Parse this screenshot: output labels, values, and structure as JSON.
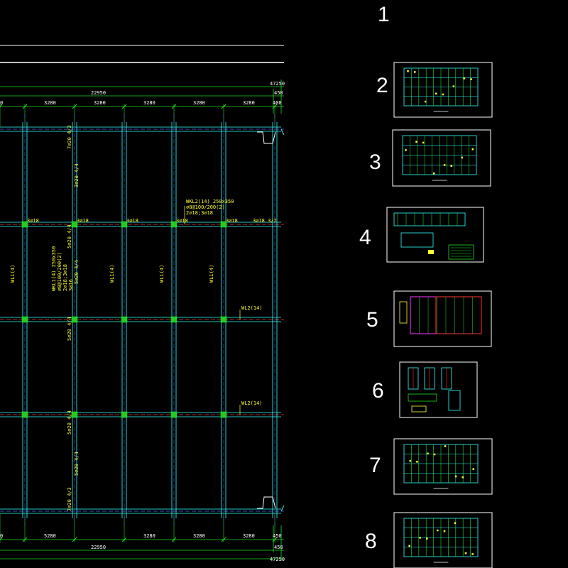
{
  "colors": {
    "background": "#000000",
    "frame": "#ffffff",
    "dimension": "#22dd22",
    "beam": "#33ffff",
    "axis": "#5a66ff",
    "axis_red": "#ff3333",
    "annotation": "#ffff33",
    "node": "#22cc22"
  },
  "plan": {
    "dim_total_top": "47250",
    "dim_total_bottom": "47250",
    "dim_span_top": "22950",
    "dim_span_bottom": "22950",
    "dim_end_top": "450",
    "dim_end_bottom": "450",
    "dim_end2_top": "400",
    "dim_end2_bottom": "450",
    "bay_top": [
      "3280",
      "3280",
      "3280",
      "3280",
      "3280"
    ],
    "bay_bottom": [
      "5280",
      "3280",
      "3280",
      "3280"
    ],
    "left_edge_top": "0",
    "left_edge_bottom": "0",
    "rebar_labels": [
      "3⌀18",
      "3⌀18",
      "3⌀18",
      "3⌀18",
      "3⌀18",
      "3⌀18 3/2"
    ],
    "label_wkl2_block": [
      "WKL2(14) 250x350",
      "⌀8@100/200(2)",
      "2⌀18;3⌀18"
    ],
    "label_wkl1_block": [
      "WKL1(4) 250x350",
      "⌀8@100/200(2)",
      "2⌀18;3⌀18",
      "3⌀16"
    ],
    "label_wl1": "WL1(4)",
    "label_wl2": "WL2(14)",
    "label_col_top": "7⌀20 4/3",
    "label_col_mid": "5⌀20 4/4",
    "label_col_low": "5⌀20 4/4",
    "label_col_bottom": "7⌀20 4/3",
    "label_col_upper": "3⌀20 4/4",
    "label_col_inner": "5⌀20 4/4"
  },
  "sheets": [
    {
      "number": "1"
    },
    {
      "number": "2"
    },
    {
      "number": "3"
    },
    {
      "number": "4"
    },
    {
      "number": "5"
    },
    {
      "number": "6"
    },
    {
      "number": "7"
    },
    {
      "number": "8"
    }
  ]
}
